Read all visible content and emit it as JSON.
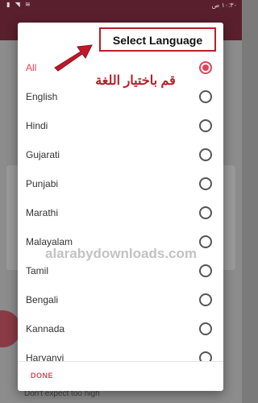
{
  "status_bar": {
    "time": "١٠:٣٠ ص"
  },
  "dialog": {
    "title": "Select Language",
    "hint_arabic": "قم باختيار اللغة",
    "languages": [
      {
        "label": "All",
        "selected": true
      },
      {
        "label": "English",
        "selected": false
      },
      {
        "label": "Hindi",
        "selected": false
      },
      {
        "label": "Gujarati",
        "selected": false
      },
      {
        "label": "Punjabi",
        "selected": false
      },
      {
        "label": "Marathi",
        "selected": false
      },
      {
        "label": "Malayalam",
        "selected": false
      },
      {
        "label": "Tamil",
        "selected": false
      },
      {
        "label": "Bengali",
        "selected": false
      },
      {
        "label": "Kannada",
        "selected": false
      },
      {
        "label": "Haryanvi",
        "selected": false
      }
    ],
    "done_label": "DONE"
  },
  "background": {
    "footer_text": "Don't expect too high"
  },
  "watermark": "alarabydownloads.com",
  "colors": {
    "accent": "#e0435a",
    "annotation_red": "#b81f2a",
    "appbar": "#5a1f2c"
  }
}
